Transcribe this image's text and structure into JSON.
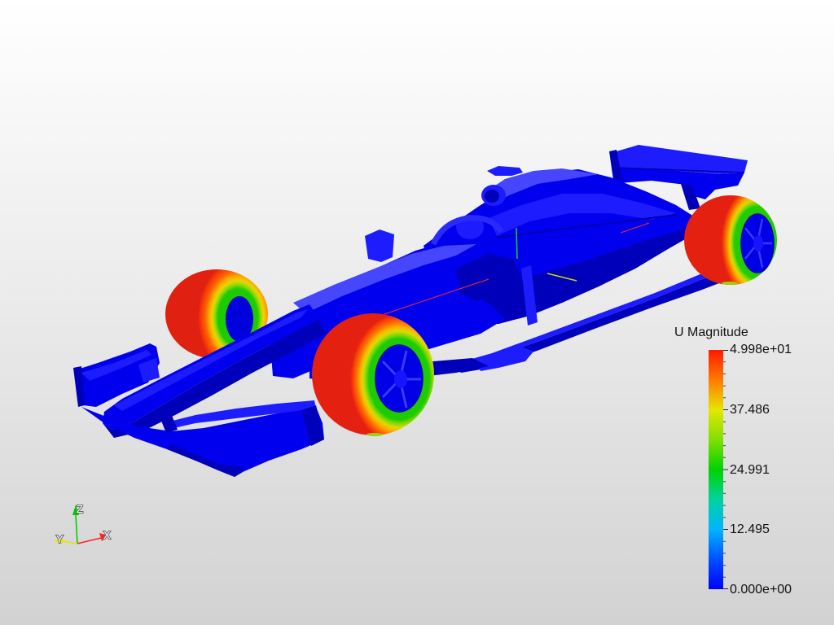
{
  "colorbar": {
    "title": "U Magnitude",
    "labels": [
      "4.998e+01",
      "37.486",
      "24.991",
      "12.495",
      "0.000e+00"
    ],
    "range": [
      0,
      49.98
    ],
    "colormap": [
      "#0000ff",
      "#0050ff",
      "#00b4ff",
      "#00d2a0",
      "#00d200",
      "#80e000",
      "#e6e600",
      "#ff7a00",
      "#ff1a00"
    ]
  },
  "orientation_axes": {
    "x_label": "X",
    "y_label": "Y",
    "z_label": "Z",
    "x_color": "#ff2020",
    "y_color": "#e6e600",
    "z_color": "#00c800"
  }
}
